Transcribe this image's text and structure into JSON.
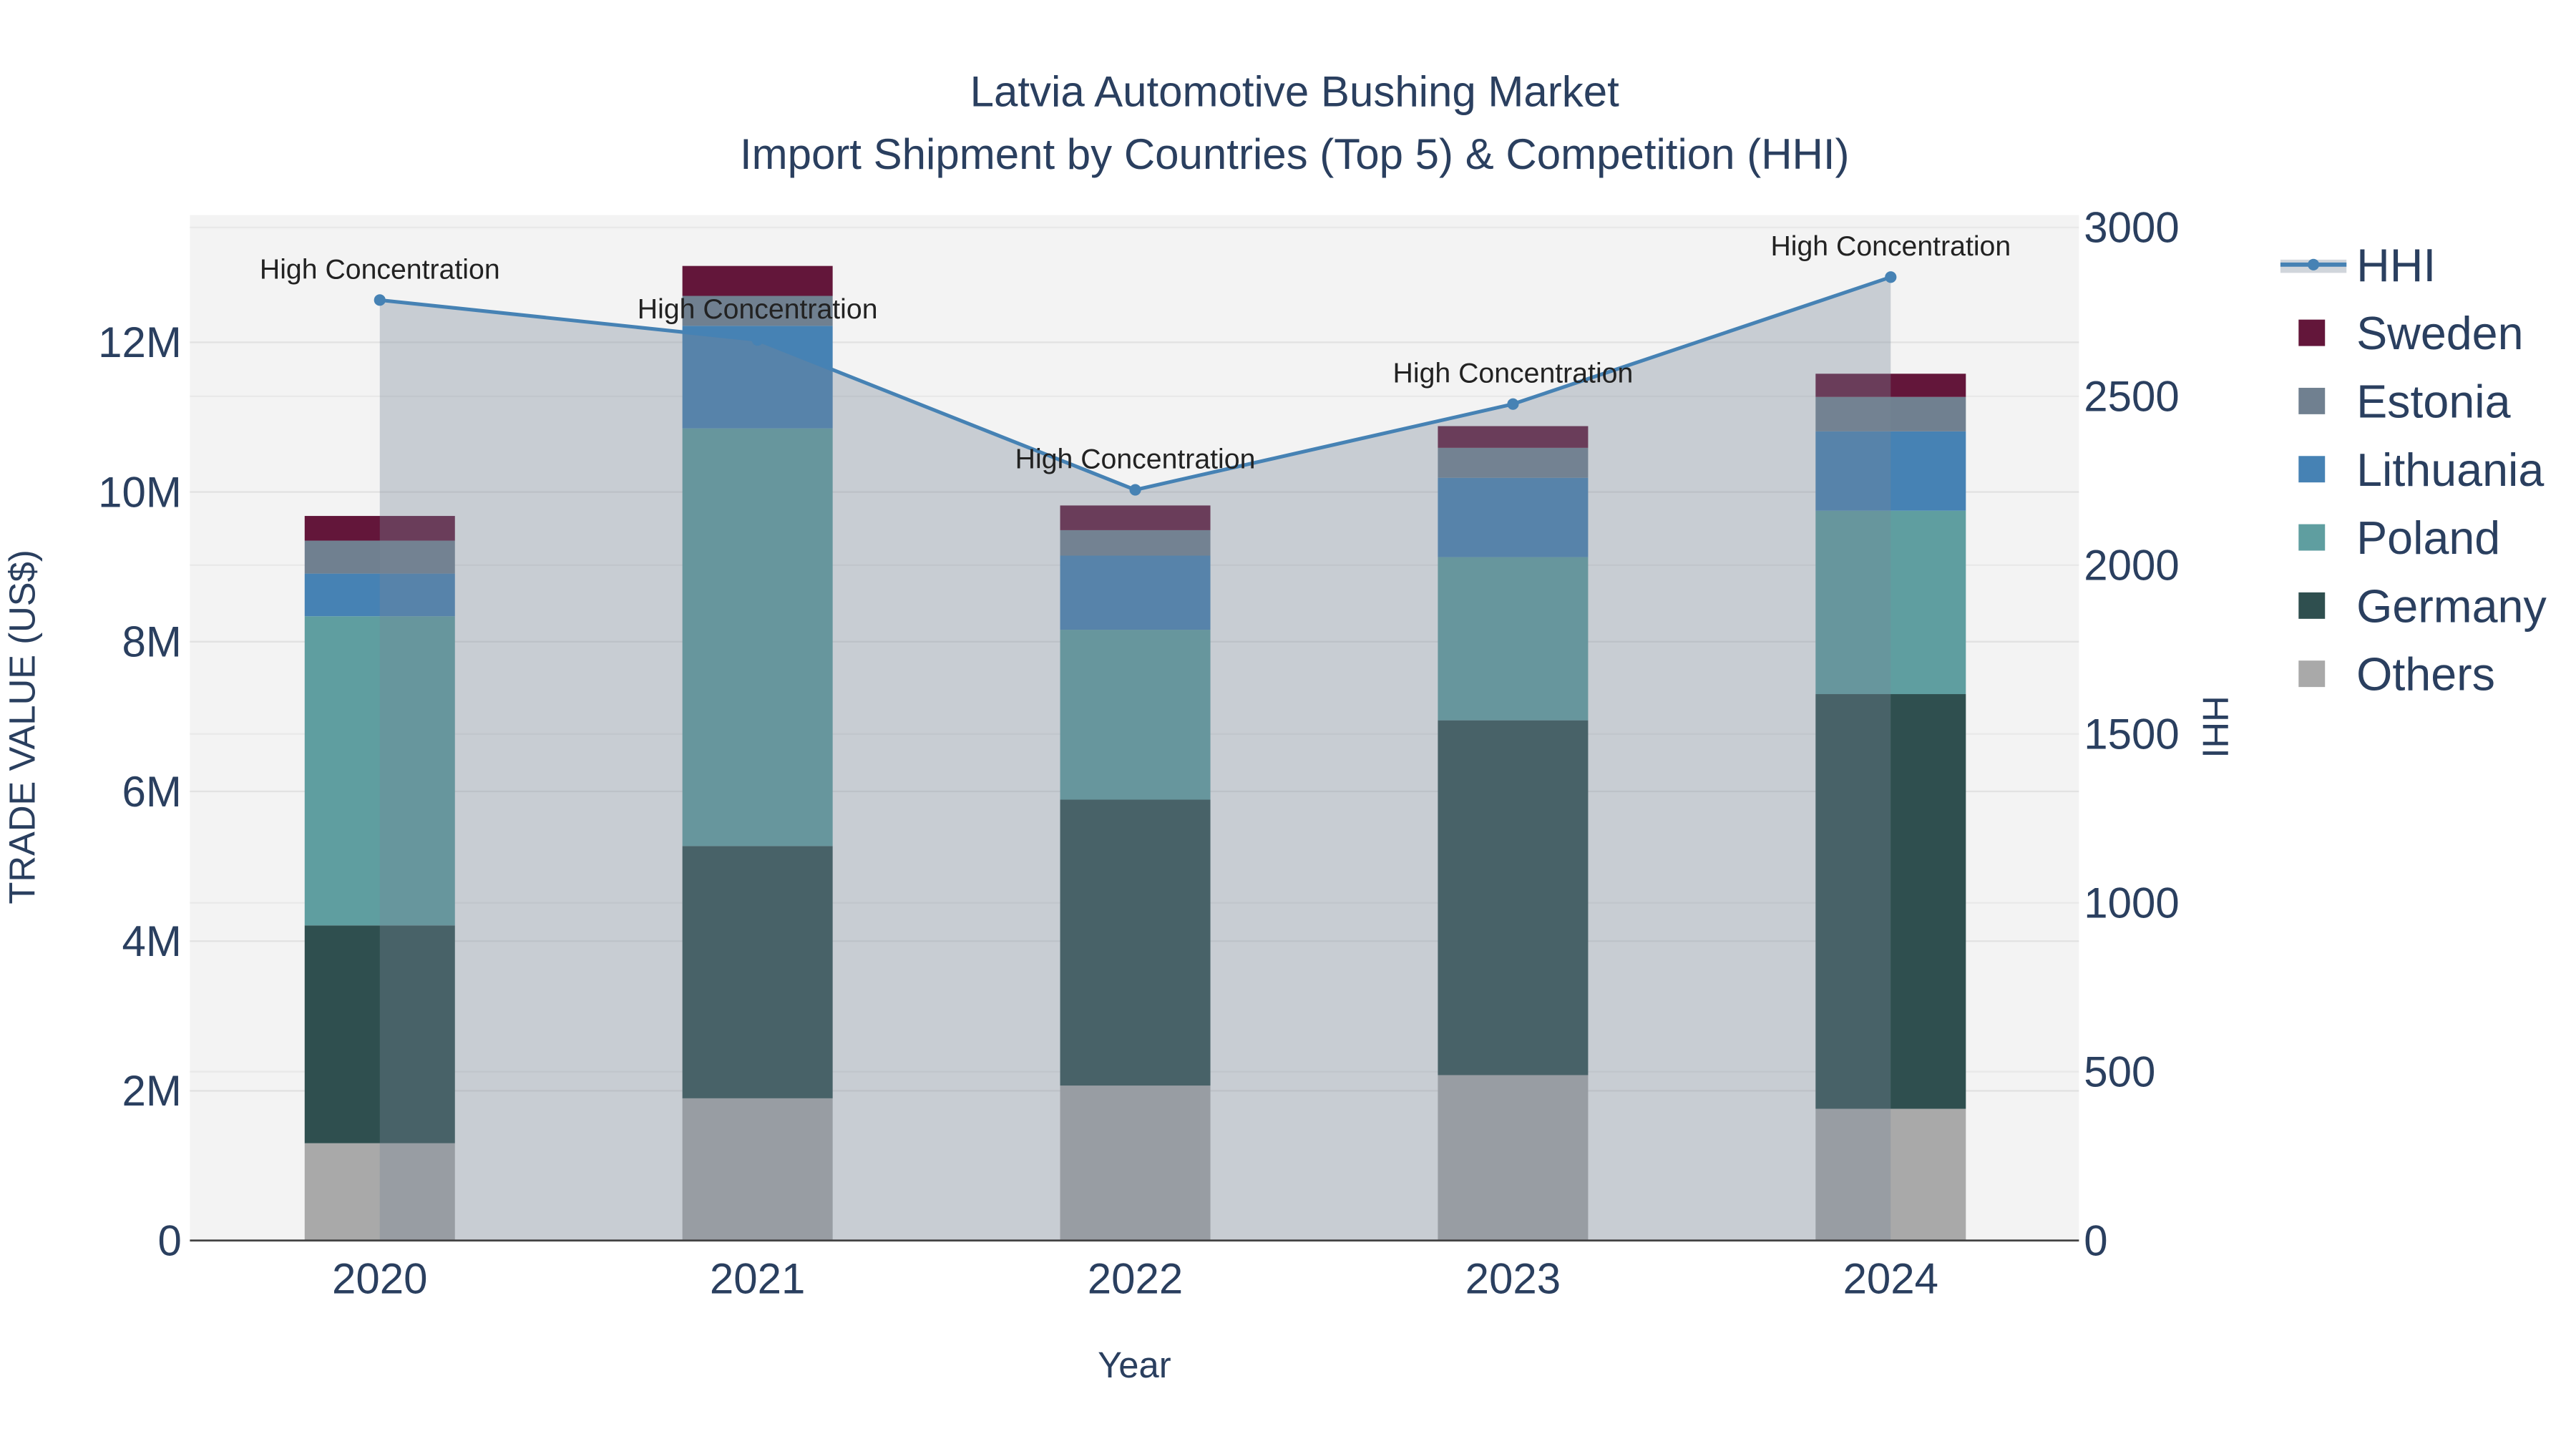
{
  "chart_data": {
    "type": "bar",
    "subtype": "stacked bar with line/area on secondary axis",
    "title": "Latvia Automotive Bushing Market",
    "subtitle": "Import Shipment by Countries (Top 5) & Competition (HHI)",
    "xlabel": "Year",
    "ylabel": "TRADE VALUE (US$)",
    "y2label": "HHI",
    "categories": [
      "2020",
      "2021",
      "2022",
      "2023",
      "2024"
    ],
    "ylim": [
      0,
      13500000
    ],
    "y2lim": [
      0,
      3000
    ],
    "yticks": [
      0,
      2000000,
      4000000,
      6000000,
      8000000,
      10000000,
      12000000
    ],
    "ytick_labels": [
      "0",
      "2M",
      "4M",
      "6M",
      "8M",
      "10M",
      "12M"
    ],
    "y2ticks": [
      0,
      500,
      1000,
      1500,
      2000,
      2500,
      3000
    ],
    "y2tick_labels": [
      "0",
      "500",
      "1000",
      "1500",
      "2000",
      "2500",
      "3000"
    ],
    "grid": true,
    "legend_position": "right",
    "series": [
      {
        "name": "Others",
        "color": "#a9a9a9",
        "values": [
          1300000,
          1900000,
          2070000,
          2210000,
          1760000
        ]
      },
      {
        "name": "Germany",
        "color": "#2f4f4f",
        "values": [
          2910000,
          3370000,
          3820000,
          4740000,
          5540000
        ]
      },
      {
        "name": "Poland",
        "color": "#5f9ea0",
        "values": [
          4130000,
          5580000,
          2270000,
          2180000,
          2450000
        ]
      },
      {
        "name": "Lithuania",
        "color": "#4682b4",
        "values": [
          570000,
          1370000,
          990000,
          1060000,
          1060000
        ]
      },
      {
        "name": "Estonia",
        "color": "#708090",
        "values": [
          440000,
          400000,
          340000,
          400000,
          460000
        ]
      },
      {
        "name": "Sweden",
        "color": "#63163a",
        "values": [
          330000,
          400000,
          330000,
          290000,
          310000
        ]
      }
    ],
    "hhi": {
      "name": "HHI",
      "color": "#4682b4",
      "values": [
        2785,
        2667,
        2223,
        2477,
        2853
      ],
      "annotations": [
        "High Concentration",
        "High Concentration",
        "High Concentration",
        "High Concentration",
        "High Concentration"
      ]
    },
    "legend_order": [
      "HHI",
      "Sweden",
      "Estonia",
      "Lithuania",
      "Poland",
      "Germany",
      "Others"
    ]
  }
}
